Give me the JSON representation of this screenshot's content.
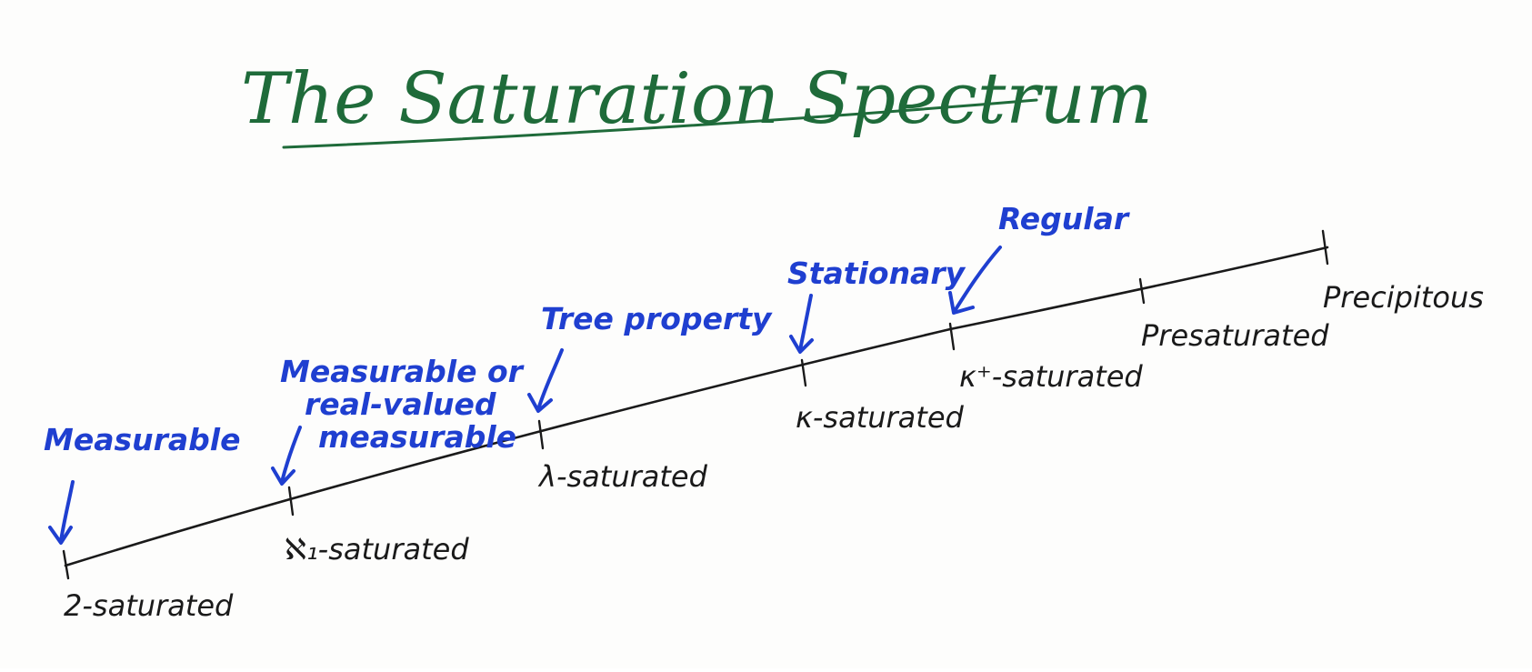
{
  "title": "The Saturation Spectrum",
  "colors": {
    "title": "#1f6b3a",
    "annotation": "#1f3fd0",
    "axis": "#1a1a1a"
  },
  "spectrum": {
    "ticks": [
      {
        "label": "2-saturated"
      },
      {
        "label": "ℵ₁-saturated"
      },
      {
        "label": "λ-saturated"
      },
      {
        "label": "κ-saturated"
      },
      {
        "label": "κ⁺-saturated"
      },
      {
        "label": "Presaturated"
      },
      {
        "label": "Precipitous"
      }
    ],
    "annotations": [
      {
        "lines": [
          "Measurable"
        ]
      },
      {
        "lines": [
          "Measurable or",
          "real-valued",
          "measurable"
        ]
      },
      {
        "lines": [
          "Tree property"
        ]
      },
      {
        "lines": [
          "Stationary"
        ]
      },
      {
        "lines": [
          "Regular"
        ]
      }
    ]
  }
}
